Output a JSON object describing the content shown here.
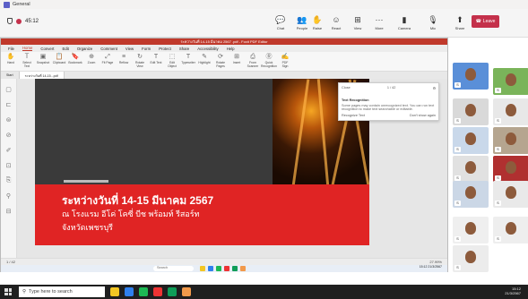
{
  "teams": {
    "window_title": "General",
    "timer": "45:12",
    "toolbar": [
      {
        "label": "Chat",
        "icon": "chat-icon",
        "glyph": "💬"
      },
      {
        "label": "People",
        "icon": "people-icon",
        "glyph": "👥"
      },
      {
        "label": "Raise",
        "icon": "hand-icon",
        "glyph": "✋"
      },
      {
        "label": "React",
        "icon": "smile-icon",
        "glyph": "☺"
      },
      {
        "label": "View",
        "icon": "grid-icon",
        "glyph": "⊞"
      },
      {
        "label": "More",
        "icon": "more-icon",
        "glyph": "···"
      },
      {
        "label": "Camera",
        "icon": "camera-off-icon",
        "glyph": "▮"
      },
      {
        "label": "Mic",
        "icon": "mic-off-icon",
        "glyph": "🎙"
      },
      {
        "label": "Share",
        "icon": "share-icon",
        "glyph": "⬆"
      }
    ],
    "participant_count": "31",
    "leave_label": "Leave",
    "accent": "#5b5fc7",
    "leave_color": "#c4314b"
  },
  "pdf": {
    "title": "ระหว่างวันที่ 14-15 มีนาคม 2567 .pdf - Foxit PDF Editor",
    "menu": [
      "File",
      "Home",
      "Convert",
      "Edit",
      "Organize",
      "Comment",
      "View",
      "Form",
      "Protect",
      "Share",
      "Accessibility",
      "Help"
    ],
    "active_menu": "Home",
    "ribbon": [
      {
        "label": "Hand",
        "glyph": "✋"
      },
      {
        "label": "Select Text",
        "glyph": "Ｔ"
      },
      {
        "label": "Snapshot",
        "glyph": "▣"
      },
      {
        "label": "Clipboard",
        "glyph": "📋"
      },
      {
        "label": "Bookmark",
        "glyph": "🔖"
      },
      {
        "label": "Zoom",
        "glyph": "⊕"
      },
      {
        "label": "Fit Page",
        "glyph": "⤢"
      },
      {
        "label": "Reflow",
        "glyph": "≡"
      },
      {
        "label": "Rotate View",
        "glyph": "↻"
      },
      {
        "label": "Edit Text",
        "glyph": "T"
      },
      {
        "label": "Edit Object",
        "glyph": "⬚"
      },
      {
        "label": "Typewriter",
        "glyph": "T"
      },
      {
        "label": "Highlight",
        "glyph": "✎"
      },
      {
        "label": "Rotate Pages",
        "glyph": "⟳"
      },
      {
        "label": "Insert",
        "glyph": "⊞"
      },
      {
        "label": "From Scanner",
        "glyph": "⎙"
      },
      {
        "label": "Quick Recognition",
        "glyph": "Ⓡ"
      },
      {
        "label": "PDF Sign",
        "glyph": "✍"
      }
    ],
    "tabs": [
      "Start",
      "ระหว่างวันที่ 14-15...pdf"
    ],
    "slide": {
      "line1": "ระหว่างวันที่ 14-15 มีนาคม 2567",
      "line2": "ณ โรงแรม อีโค่ โคซี่ บีช พร้อมท์ รีสอร์ท",
      "line3": "จังหวัดเพชรบุรี"
    },
    "ocr_panel": {
      "title": "Text Recognition",
      "page_info": "1 / 42",
      "heading": "Text Recognition",
      "body": "Some pages may contain unrecognized text. You can run text recognition to make text searchable or editable.",
      "action_left": "Recognize Text",
      "action_right": "Don't show again"
    },
    "status": {
      "page": "1 / 42",
      "zoom": "27.99%"
    },
    "inner_search": "Search",
    "inner_clock": "15:12\n21/3/2567"
  },
  "participants": [
    {
      "badge": "",
      "bg": "#5a8fd8"
    },
    {
      "badge": "",
      "bg": "#7ab45a"
    },
    {
      "badge": "",
      "bg": "#d9d9d9"
    },
    {
      "badge": "",
      "bg": "#e8e8e8"
    },
    {
      "badge": "",
      "bg": "#c9d8ea"
    },
    {
      "badge": "",
      "bg": "#b5a58f"
    },
    {
      "badge": "",
      "bg": "#e1e1e1"
    },
    {
      "badge": "",
      "bg": "#b03030"
    },
    {
      "badge": "",
      "bg": "#cbd7e6"
    },
    {
      "badge": "",
      "bg": "#e9e9e9"
    },
    {
      "badge": "",
      "bg": "#efefef"
    },
    {
      "badge": "",
      "bg": "#eeeeee"
    },
    {
      "badge": "",
      "bg": "#ececec"
    }
  ],
  "taskbar": {
    "search_placeholder": "Type here to search",
    "apps": [
      "#f3c623",
      "#2f80ed",
      "#1db954",
      "#e33",
      "#0f9d58",
      "#f2994a"
    ],
    "clock": "15:12",
    "date": "21/3/2567",
    "lang": "ENG"
  }
}
